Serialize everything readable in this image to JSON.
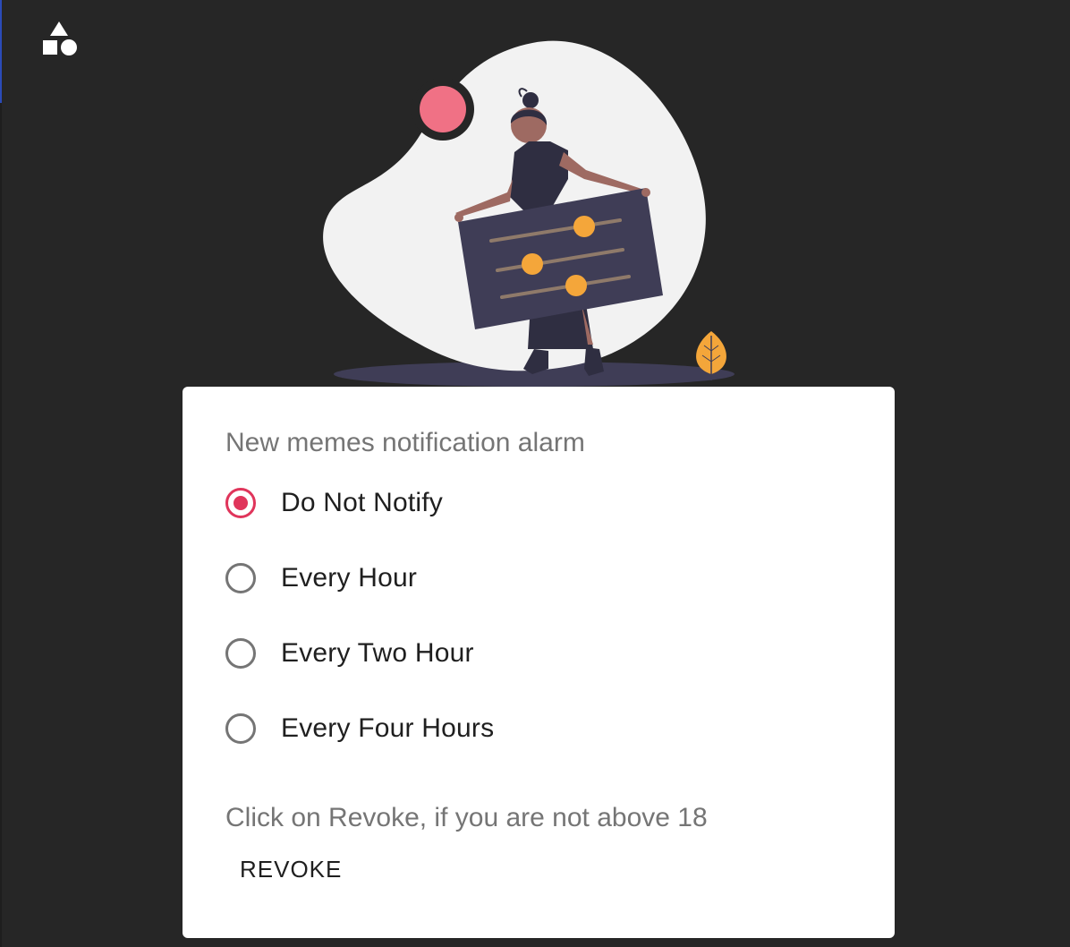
{
  "app": {
    "logo_icon": "shapes-logo-icon"
  },
  "illustration": {
    "name": "woman-holding-settings-board-illustration",
    "colors": {
      "blob": "#f2f2f2",
      "board": "#3f3d56",
      "slider_knob": "#f4a63a",
      "accent_circle": "#f07185",
      "leaf": "#f4a63a"
    }
  },
  "settings": {
    "group_label": "New memes notification alarm",
    "accent_color": "#e0355b",
    "options": [
      {
        "label": "Do Not Notify",
        "selected": true
      },
      {
        "label": "Every Hour",
        "selected": false
      },
      {
        "label": "Every Two Hour",
        "selected": false
      },
      {
        "label": "Every Four Hours",
        "selected": false
      }
    ],
    "revoke_text": "Click on Revoke, if you are not above 18",
    "revoke_label": "REVOKE"
  }
}
